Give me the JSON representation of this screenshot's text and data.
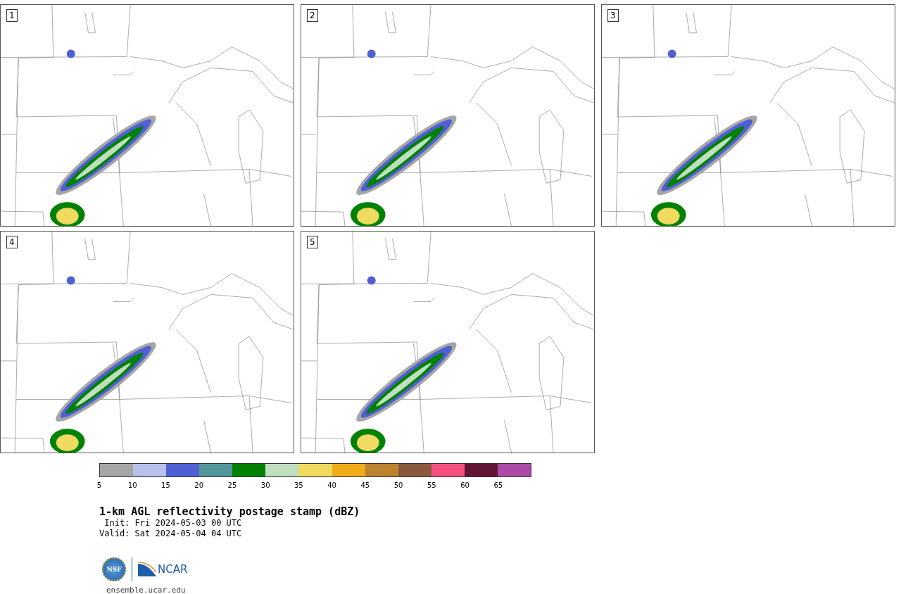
{
  "panels": [
    {
      "label": "1"
    },
    {
      "label": "2"
    },
    {
      "label": "3"
    },
    {
      "label": "4"
    },
    {
      "label": "5"
    }
  ],
  "colorbar": {
    "bands": [
      {
        "color": "#a6a6a6"
      },
      {
        "color": "#b7c1ec"
      },
      {
        "color": "#4f5fd6"
      },
      {
        "color": "#50969b"
      },
      {
        "color": "#008200"
      },
      {
        "color": "#bfdfbf"
      },
      {
        "color": "#f0da60"
      },
      {
        "color": "#f0ad18"
      },
      {
        "color": "#bb8330"
      },
      {
        "color": "#8b5a3c"
      },
      {
        "color": "#f55080"
      },
      {
        "color": "#621535"
      },
      {
        "color": "#ab4ba6"
      }
    ],
    "ticks": [
      "5",
      "10",
      "15",
      "20",
      "25",
      "30",
      "35",
      "40",
      "45",
      "50",
      "55",
      "60",
      "65"
    ]
  },
  "title": "1-km AGL reflectivity postage stamp (dBZ)",
  "init": " Init: Fri 2024-05-03 00 UTC",
  "valid": "Valid: Sat 2024-05-04 04 UTC",
  "logo": {
    "nsf": "NSF",
    "ncar": "NCAR"
  },
  "url": "ensemble.ucar.edu"
}
